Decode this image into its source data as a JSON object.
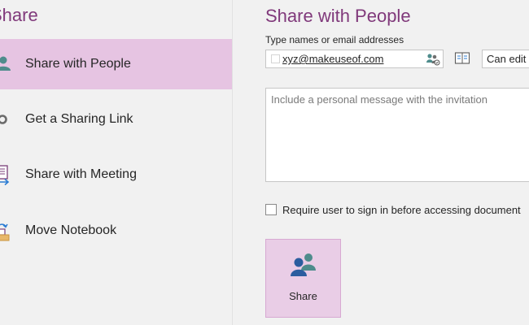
{
  "left_panel": {
    "title": "Share",
    "items": [
      {
        "label": "Share with People",
        "icon": "share-people-icon",
        "selected": true
      },
      {
        "label": "Get a Sharing Link",
        "icon": "link-icon",
        "selected": false
      },
      {
        "label": "Share with Meeting",
        "icon": "meeting-icon",
        "selected": false
      },
      {
        "label": "Move Notebook",
        "icon": "move-notebook-icon",
        "selected": false
      }
    ]
  },
  "main": {
    "title": "Share with People",
    "names_label": "Type names or email addresses",
    "names_value": "xyz@makeuseof.com",
    "permission": "Can edit",
    "message_placeholder": "Include a personal message with the invitation",
    "signin_label": "Require user to sign in before accessing document",
    "share_button": "Share"
  },
  "colors": {
    "accent_title": "#80397b",
    "selected_bg": "#e6c4e2",
    "share_button_bg": "#e9cde6"
  }
}
